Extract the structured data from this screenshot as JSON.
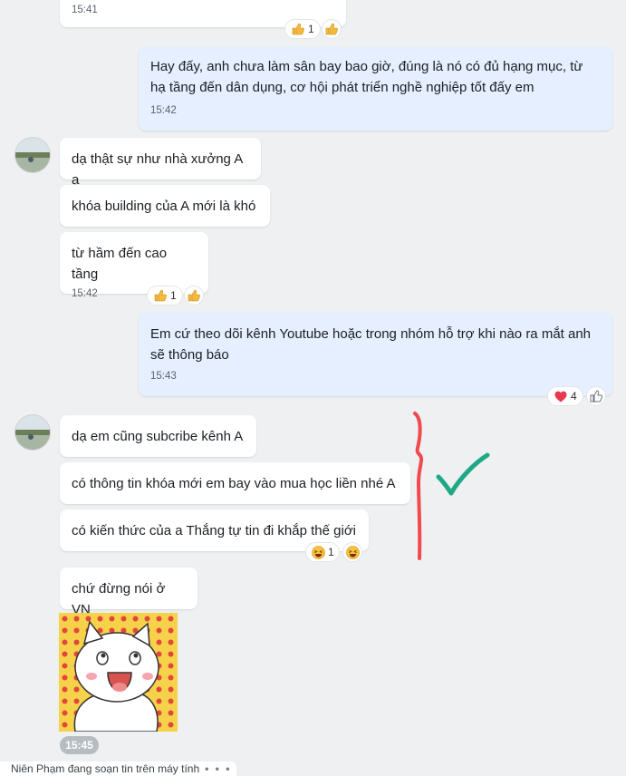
{
  "messages": [
    {
      "time": "15:41"
    },
    {
      "text": "Hay đấy, anh chưa làm sân bay bao giờ, đúng là nó có đủ hạng mục, từ hạ tầng đến dân dụng, cơ hội phát triển nghề nghiệp tốt đấy em",
      "time": "15:42"
    },
    {
      "text": "dạ thật sự như nhà xưởng A ạ"
    },
    {
      "text": "khóa building của A mới là khó"
    },
    {
      "text": "từ hầm đến cao tầng",
      "time": "15:42"
    },
    {
      "text": "Em cứ theo dõi kênh Youtube hoặc trong nhóm hỗ trợ khi nào ra mắt anh sẽ thông báo",
      "time": "15:43"
    },
    {
      "text": "dạ em cũng subcribe kênh A"
    },
    {
      "text": "có thông tin khóa mới em bay vào mua học liền nhé A"
    },
    {
      "text": "có kiến thức của a Thắng tự tin đi khắp thế giới"
    },
    {
      "text": "chứ đừng nói ở VN"
    }
  ],
  "reactions": {
    "r1": {
      "icon": "thumbs-up-icon",
      "count": "1"
    },
    "r5": {
      "icon": "thumbs-up-icon",
      "count": "1"
    },
    "r6": {
      "icon": "heart-icon",
      "count": "4"
    },
    "r9": {
      "icon": "laugh-icon",
      "count": "1"
    }
  },
  "sticker_time": "15:45",
  "typing_status": "Niên Phạm đang soạn tin trên máy tính",
  "typing_dots": "• • •",
  "colors": {
    "background": "#eef0f1",
    "my_bubble": "#e5efff",
    "other_bubble": "#ffffff",
    "annotation_bracket": "#f04a50",
    "annotation_check": "#1fa884"
  }
}
